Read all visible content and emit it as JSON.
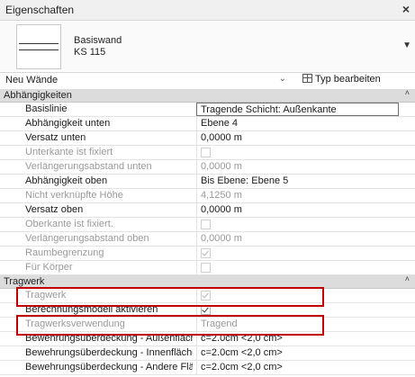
{
  "window": {
    "title": "Eigenschaften",
    "close_label": "×"
  },
  "type_selector": {
    "family": "Basiswand",
    "type": "KS 115"
  },
  "filter": {
    "value": "Neu Wände",
    "edit_type_label": "Typ bearbeiten"
  },
  "groups": [
    {
      "label": "Abhängigkeiten",
      "collapse_glyph": "˄"
    },
    {
      "label": "Tragwerk",
      "collapse_glyph": "˄"
    }
  ],
  "constraints": [
    {
      "name": "Basislinie",
      "value": "Tragende Schicht: Außenkante",
      "state": "selected"
    },
    {
      "name": "Abhängigkeit unten",
      "value": "Ebene 4"
    },
    {
      "name": "Versatz unten",
      "value": "0,0000 m"
    },
    {
      "name": "Unterkante ist fixiert",
      "checkbox": false,
      "state": "disabled"
    },
    {
      "name": "Verlängerungsabstand unten",
      "value": "0,0000 m",
      "state": "disabled"
    },
    {
      "name": "Abhängigkeit oben",
      "value": "Bis Ebene: Ebene 5"
    },
    {
      "name": "Nicht verknüpfte Höhe",
      "value": "4,1250 m",
      "state": "disabled"
    },
    {
      "name": "Versatz oben",
      "value": "0,0000 m"
    },
    {
      "name": "Oberkante ist fixiert.",
      "checkbox": false,
      "state": "disabled"
    },
    {
      "name": "Verlängerungsabstand oben",
      "value": "0,0000 m",
      "state": "disabled"
    },
    {
      "name": "Raumbegrenzung",
      "checkbox": true,
      "state": "disabled"
    },
    {
      "name": "Für Körper",
      "checkbox": false,
      "state": "disabled"
    }
  ],
  "structural": [
    {
      "name": "Tragwerk",
      "checkbox": true,
      "state": "disabled"
    },
    {
      "name": "Berechnungsmodell aktivieren",
      "checkbox": true
    },
    {
      "name": "Tragwerksverwendung",
      "value": "Tragend",
      "state": "disabled"
    },
    {
      "name": "Bewehrungsüberdeckung - Außenfläche",
      "value": "c=2.0cm <2,0 cm>"
    },
    {
      "name": "Bewehrungsüberdeckung - Innenfläche",
      "value": "c=2.0cm <2,0 cm>"
    },
    {
      "name": "Bewehrungsüberdeckung - Andere Flächen",
      "value": "c=2.0cm <2,0 cm>"
    }
  ],
  "colors": {
    "highlight": "#c00000",
    "group_bg": "#dcdcdc"
  }
}
